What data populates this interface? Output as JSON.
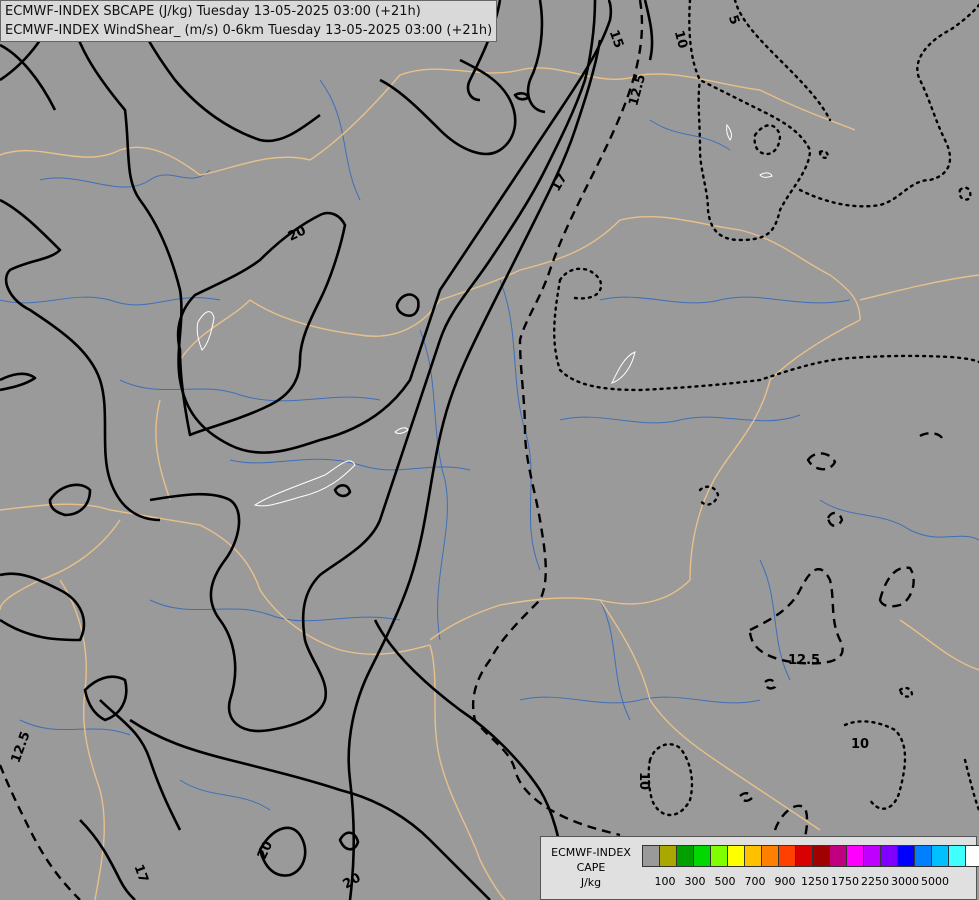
{
  "title": {
    "line1": "ECMWF-INDEX SBCAPE (J/kg) Tuesday 13-05-2025 03:00 (+21h)",
    "line2": "ECMWF-INDEX WindShear_ (m/s) 0-6km Tuesday 13-05-2025 03:00 (+21h)"
  },
  "colors": {
    "background": "#9a9a9a",
    "border_lines": "#e8c08a",
    "rivers": "#3f6fb8",
    "contours": "#000000",
    "cape_outline": "#ffffff"
  },
  "contour_labels": [
    "20",
    "17",
    "15",
    "12.5",
    "10",
    "5",
    "12.5",
    "10",
    "10",
    "12.5",
    "17",
    "20",
    "20"
  ],
  "legend": {
    "title": "ECMWF-INDEX",
    "subtitle": "CAPE",
    "unit": "J/kg",
    "swatch_colors": [
      "#9a9a9a",
      "#a8a800",
      "#00a000",
      "#00d800",
      "#80ff00",
      "#ffff00",
      "#ffc000",
      "#ff8000",
      "#ff4000",
      "#d80000",
      "#a00000",
      "#c00080",
      "#ff00ff",
      "#c000ff",
      "#8000ff",
      "#0000ff",
      "#0080ff",
      "#00c0ff",
      "#40ffff",
      "#ffffff"
    ],
    "ticks": [
      "100",
      "300",
      "500",
      "700",
      "900",
      "1250",
      "1750",
      "2250",
      "3000",
      "5000"
    ]
  }
}
